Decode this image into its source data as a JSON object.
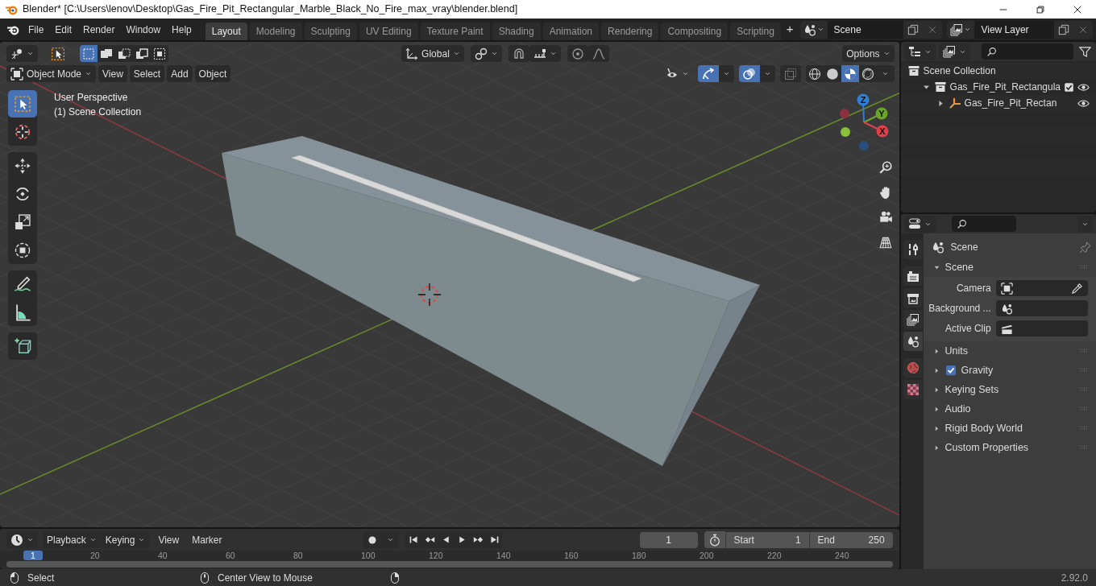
{
  "window": {
    "title": "Blender* [C:\\Users\\lenov\\Desktop\\Gas_Fire_Pit_Rectangular_Marble_Black_No_Fire_max_vray\\blender.blend]"
  },
  "menu": [
    "File",
    "Edit",
    "Render",
    "Window",
    "Help"
  ],
  "workspaces": [
    {
      "label": "Layout",
      "selected": true
    },
    {
      "label": "Modeling",
      "selected": false
    },
    {
      "label": "Sculpting",
      "selected": false
    },
    {
      "label": "UV Editing",
      "selected": false
    },
    {
      "label": "Texture Paint",
      "selected": false
    },
    {
      "label": "Shading",
      "selected": false
    },
    {
      "label": "Animation",
      "selected": false
    },
    {
      "label": "Rendering",
      "selected": false
    },
    {
      "label": "Compositing",
      "selected": false
    },
    {
      "label": "Scripting",
      "selected": false
    }
  ],
  "add_workspace": "+",
  "scene": {
    "value": "Scene"
  },
  "view_layer": {
    "value": "View Layer"
  },
  "viewport": {
    "orientation": "Global",
    "options": "Options",
    "mode": "Object Mode",
    "menus": [
      "View",
      "Select",
      "Add",
      "Object"
    ],
    "select_modes": [
      {
        "kind": "set",
        "selected": true
      },
      {
        "kind": "extend",
        "selected": false
      },
      {
        "kind": "subtract",
        "selected": false
      },
      {
        "kind": "difference",
        "selected": false
      },
      {
        "kind": "intersect",
        "selected": false
      }
    ],
    "toggles": [
      {
        "kind": "gizmo",
        "on": true
      },
      {
        "kind": "overlay",
        "on": true
      },
      {
        "kind": "xray",
        "on": false
      }
    ],
    "shading": [
      {
        "kind": "wireframe",
        "selected": false
      },
      {
        "kind": "solid",
        "selected": false
      },
      {
        "kind": "material",
        "selected": true
      },
      {
        "kind": "rendered",
        "selected": false
      }
    ],
    "overlay_text": [
      "User Perspective",
      "(1) Scene Collection"
    ],
    "tools": [
      {
        "kind": "select",
        "selected": true
      },
      {
        "kind": "cursor",
        "selected": false
      },
      {
        "kind": "move",
        "selected": false
      },
      {
        "kind": "rotate",
        "selected": false
      },
      {
        "kind": "scale",
        "selected": false
      },
      {
        "kind": "transform",
        "selected": false
      },
      {
        "kind": "annotate",
        "selected": false
      },
      {
        "kind": "measure",
        "selected": false
      },
      {
        "kind": "addcube",
        "selected": false
      }
    ],
    "axes": [
      {
        "kind": "z",
        "label": "Z"
      },
      {
        "kind": "y",
        "label": "Y"
      },
      {
        "kind": "x",
        "label": "X"
      }
    ]
  },
  "outliner": {
    "items": [
      {
        "label": "Scene Collection",
        "kind": "scene",
        "children": [
          {
            "label": "Gas_Fire_Pit_Rectangula",
            "kind": "collection",
            "expanded": true,
            "checked": true,
            "children": [
              {
                "label": "Gas_Fire_Pit_Rectan",
                "kind": "empty",
                "expanded": false
              }
            ]
          }
        ]
      }
    ]
  },
  "properties": {
    "tabs": [
      {
        "kind": "tool",
        "selected": false
      },
      {
        "kind": "render",
        "selected": false
      },
      {
        "kind": "output",
        "selected": false
      },
      {
        "kind": "view_layer",
        "selected": false
      },
      {
        "kind": "scene",
        "selected": true
      },
      {
        "kind": "world",
        "selected": false
      },
      {
        "kind": "texture",
        "selected": false
      }
    ],
    "context": "Scene",
    "panels": [
      {
        "label": "Scene",
        "expanded": true,
        "fields": [
          {
            "label": "Camera",
            "kind": "camera"
          },
          {
            "label": "Background ...",
            "kind": "scene"
          },
          {
            "label": "Active Clip",
            "kind": "clip"
          }
        ]
      },
      {
        "label": "Units",
        "expanded": false
      },
      {
        "label": "Gravity",
        "expanded": false,
        "toggle": {
          "checked": true
        }
      },
      {
        "label": "Keying Sets",
        "expanded": false
      },
      {
        "label": "Audio",
        "expanded": false
      },
      {
        "label": "Rigid Body World",
        "expanded": false
      },
      {
        "label": "Custom Properties",
        "expanded": false
      }
    ]
  },
  "timeline": {
    "dropdowns": [
      "Playback",
      "Keying"
    ],
    "menus": [
      "View",
      "Marker"
    ],
    "current_frame": "1",
    "start": {
      "label": "Start",
      "value": "1"
    },
    "end": {
      "label": "End",
      "value": "250"
    },
    "ruler": {
      "current": "1",
      "ticks": [
        "20",
        "40",
        "60",
        "80",
        "100",
        "120",
        "140",
        "160",
        "180",
        "200",
        "220",
        "240"
      ]
    }
  },
  "status_bar": {
    "hints": [
      {
        "kind": "left",
        "label": "Select"
      },
      {
        "kind": "middle",
        "label": "Center View to Mouse"
      },
      {
        "kind": "right"
      }
    ],
    "version": "2.92.0"
  }
}
